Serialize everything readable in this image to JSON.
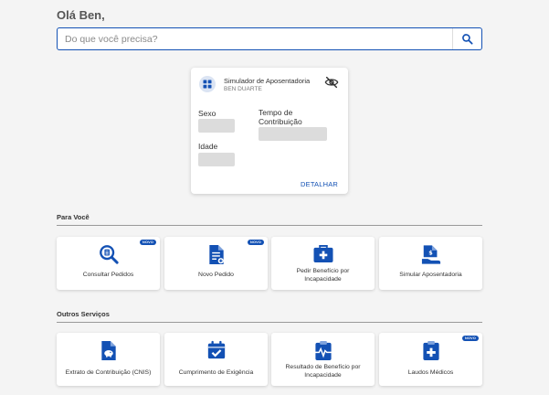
{
  "greeting": "Olá Ben,",
  "search": {
    "placeholder": "Do que você precisa?",
    "icon": "search-icon"
  },
  "simulator": {
    "title": "Simulador de Aposentadoria",
    "user": "BEN DUARTE",
    "fields": {
      "sexo": "Sexo",
      "tempo_line1": "Tempo de",
      "tempo_line2": "Contribuição",
      "idade": "Idade"
    },
    "detail_link": "DETALHAR",
    "icons": {
      "main": "grid-icon",
      "visibility": "eye-off-icon"
    }
  },
  "sections": {
    "para_voce": {
      "title": "Para Você",
      "tiles": [
        {
          "label": "Consultar Pedidos",
          "badge": "NOVO",
          "icon": "search-document-icon"
        },
        {
          "label": "Novo Pedido",
          "badge": "NOVO",
          "icon": "new-document-icon"
        },
        {
          "label_line1": "Pedir Benefício por",
          "label_line2": "Incapacidade",
          "icon": "medical-briefcase-icon"
        },
        {
          "label": "Simular Aposentadoria",
          "icon": "document-hand-icon"
        }
      ]
    },
    "outros": {
      "title": "Outros Serviços",
      "tiles": [
        {
          "label": "Extrato de Contribuição (CNIS)",
          "icon": "piggy-document-icon"
        },
        {
          "label": "Cumprimento de Exigência",
          "icon": "calendar-check-icon"
        },
        {
          "label_line1": "Resultado de Benefício por",
          "label_line2": "Incapacidade",
          "icon": "clipboard-pulse-icon"
        },
        {
          "label": "Laudos Médicos",
          "badge": "NOVO",
          "icon": "clipboard-plus-icon"
        }
      ]
    }
  },
  "colors": {
    "accent": "#1351b4",
    "background": "#f4f4f4",
    "placeholder": "#dcdcdc"
  }
}
